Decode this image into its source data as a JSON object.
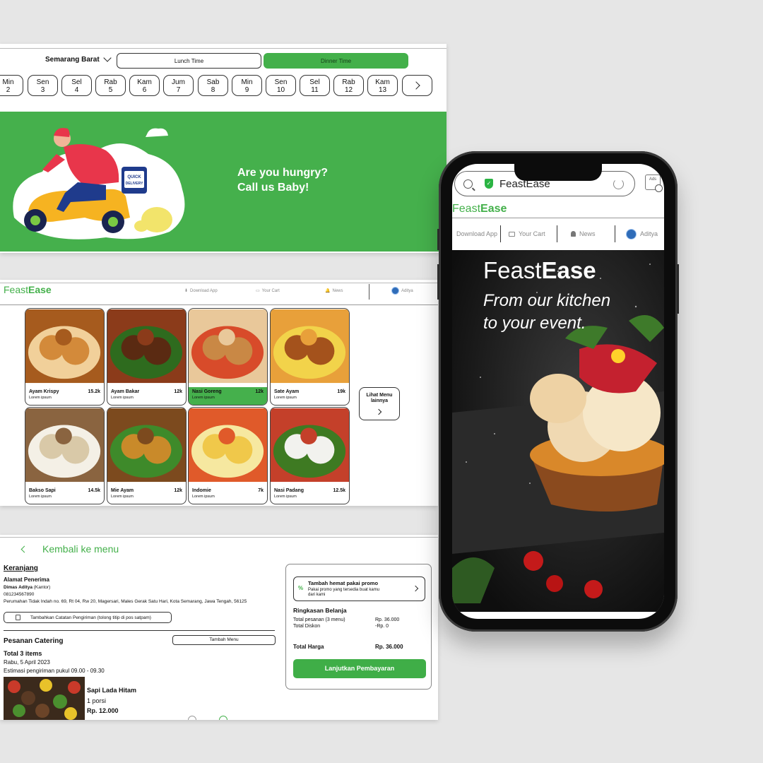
{
  "panel1": {
    "city": "Semarang Barat",
    "lunch_label": "Lunch Time",
    "dinner_label": "Dinner Time",
    "days": [
      {
        "day": "Min",
        "date": "2"
      },
      {
        "day": "Sen",
        "date": "3"
      },
      {
        "day": "Sel",
        "date": "4"
      },
      {
        "day": "Rab",
        "date": "5"
      },
      {
        "day": "Kam",
        "date": "6"
      },
      {
        "day": "Jum",
        "date": "7"
      },
      {
        "day": "Sab",
        "date": "8"
      },
      {
        "day": "Min",
        "date": "9"
      },
      {
        "day": "Sen",
        "date": "10"
      },
      {
        "day": "Sel",
        "date": "11"
      },
      {
        "day": "Rab",
        "date": "12"
      },
      {
        "day": "Kam",
        "date": "13"
      }
    ],
    "banner_line1": "Are you hungry?",
    "banner_line2": "Call us Baby!",
    "badge_line1": "QUICK",
    "badge_line2": "DELIVERY"
  },
  "panel2": {
    "logo_a": "Feast",
    "logo_b": "Ease",
    "nav_download": "Download App",
    "nav_cart": "Your Cart",
    "nav_news": "News",
    "nav_user": "Aditya",
    "menu": [
      {
        "name": "Ayam Krispy",
        "price": "15.2k",
        "desc": "Lorem ipsum"
      },
      {
        "name": "Ayam Bakar",
        "price": "12k",
        "desc": "Lorem ipsum"
      },
      {
        "name": "Nasi Goreng",
        "price": "12k",
        "desc": "Lorem ipsum"
      },
      {
        "name": "Sate Ayam",
        "price": "19k",
        "desc": "Lorem ipsum"
      },
      {
        "name": "Bakso Sapi",
        "price": "14.5k",
        "desc": "Lorem ipsum"
      },
      {
        "name": "Mie Ayam",
        "price": "12k",
        "desc": "Lorem ipsum"
      },
      {
        "name": "Indomie",
        "price": "7k",
        "desc": "Lorem ipsum"
      },
      {
        "name": "Nasi Padang",
        "price": "12.5k",
        "desc": "Lorem ipsum"
      }
    ],
    "more_line1": "Lihat Menu",
    "more_line2": "lainnya"
  },
  "panel3": {
    "back_label": "Kembali ke menu",
    "cart_title": "Keranjang",
    "address_label": "Alamat Penerima",
    "recipient_name": "Dimas Aditya",
    "recipient_tag": "(Kantor)",
    "phone": "081234567890",
    "address": "Perumahan Tidak Indah no. 69, Rt 04, Rw 20, Magersari, Males Gerak Satu Hari, Kota Semarang, Jawa Tengah, 56125",
    "note_button": "Tambahkan Catatan Pengiriman (tolong titip di pos satpam)",
    "catering_title": "Pesanan Catering",
    "add_menu_button": "Tambah Menu",
    "total_items": "Total 3 items",
    "order_date": "Rabu, 5 April 2023",
    "order_estimate": "Estimasi pengiriman pukul 09.00 - 09.30",
    "dish_name": "Sapi Lada Hitam",
    "dish_qty": "1 porsi",
    "dish_price": "Rp. 12.000",
    "promo_title": "Tambah hemat pakai promo",
    "promo_sub": "Pakai promo yang tersedia buat kamu dari kami",
    "summary_title": "Ringkasan Belanja",
    "order_total_label": "Total pesanan (3 menu)",
    "order_total_value": "Rp. 36.000",
    "discount_label": "Total Diskon",
    "discount_value": "-Rp. 0",
    "grand_total_label": "Total Harga",
    "grand_total_value": "Rp. 36.000",
    "pay_button": "Lanjutkan Pembayaran"
  },
  "phone": {
    "url": "FeastEase",
    "ads_label": "Ads",
    "brand_a": "Feast",
    "brand_b": "Ease",
    "nav_download": "Download App",
    "nav_cart": "Your Cart",
    "nav_news": "News",
    "nav_user": "Aditya",
    "hero_brand_a": "Feast",
    "hero_brand_b": "Ease",
    "hero_tag_line1": "From our kitchen",
    "hero_tag_line2": "to your event."
  },
  "colors": {
    "brand_green": "#43b04a",
    "banner_green": "#45b04c",
    "hero_bg": "#151515"
  }
}
